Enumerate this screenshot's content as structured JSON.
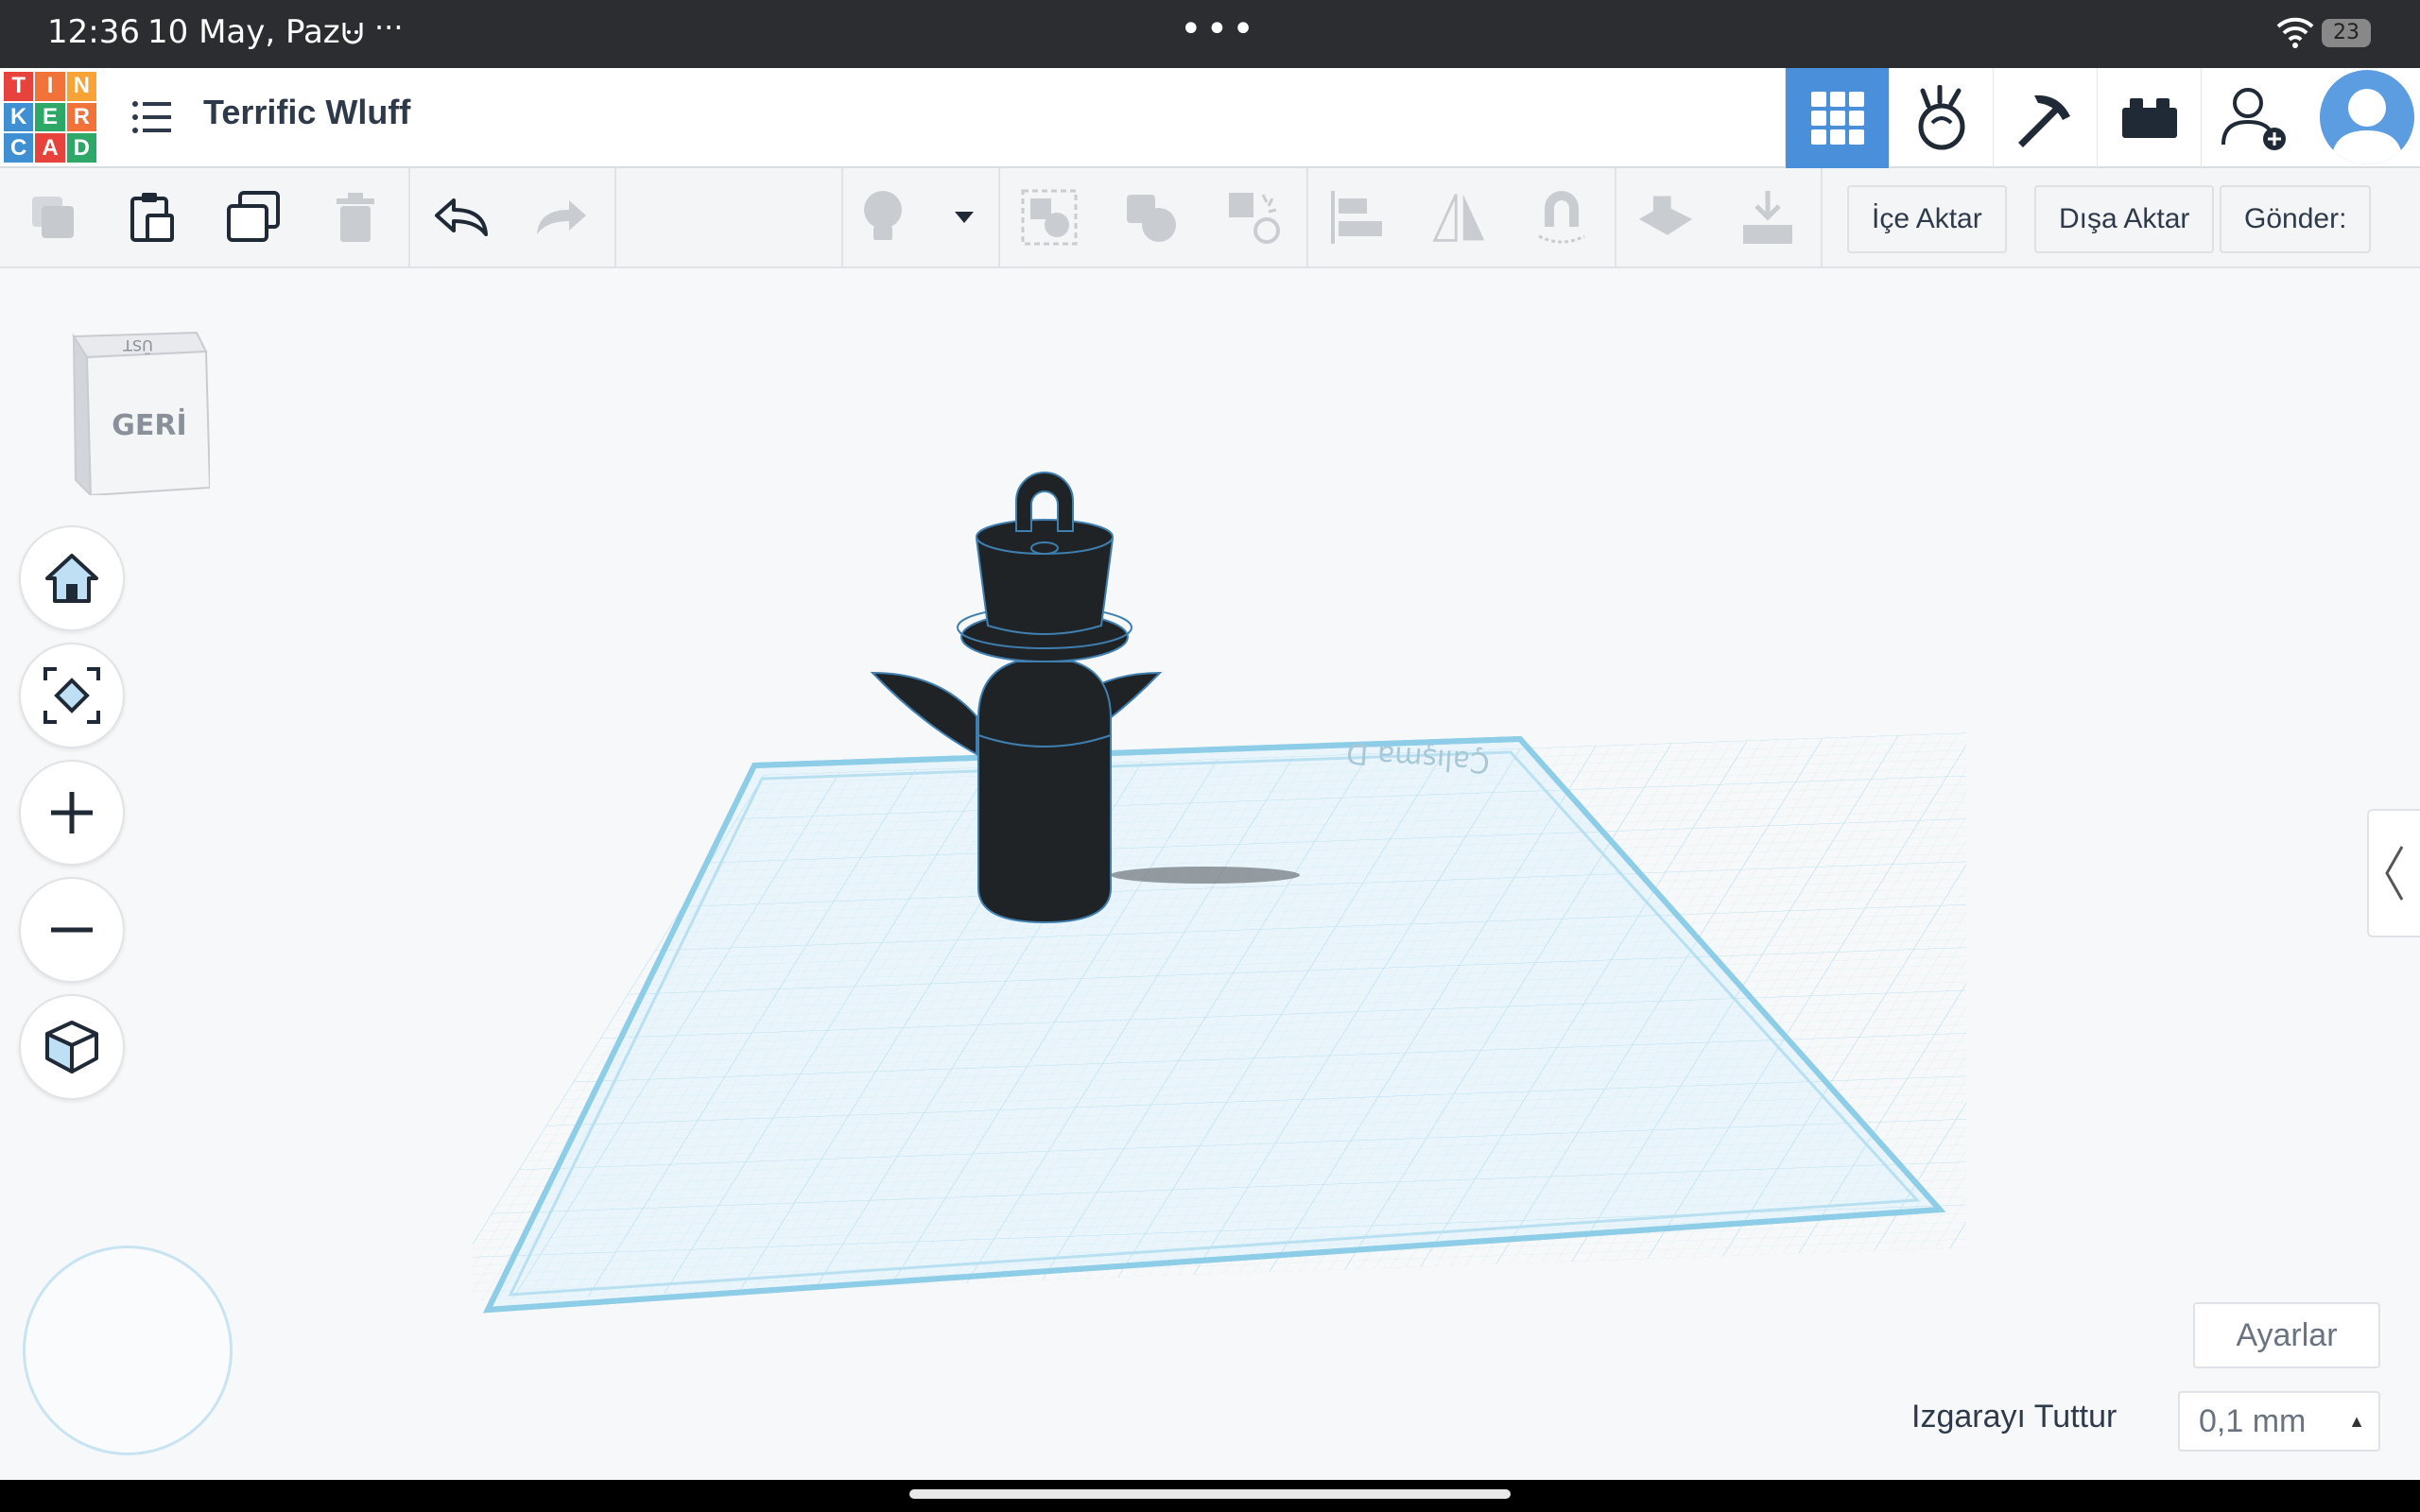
{
  "status": {
    "time": "12:36",
    "date": "10 May, Paz",
    "more": "···",
    "battery": "23"
  },
  "header": {
    "logo_letters": [
      "T",
      "I",
      "N",
      "K",
      "E",
      "R",
      "C",
      "A",
      "D"
    ],
    "logo_colors": [
      "#e8423c",
      "#f2733a",
      "#f7a335",
      "#3f8fd3",
      "#2ea866",
      "#f2733a",
      "#3f8fd3",
      "#e8423c",
      "#2ea866"
    ],
    "project_title": "Terrific Wluff"
  },
  "toolbar": {
    "import_label": "İçe Aktar",
    "export_label": "Dışa Aktar",
    "send_label": "Gönder:"
  },
  "viewcube": {
    "front_label": "GERİ",
    "top_label": "ÜST"
  },
  "workplane": {
    "label": "Çalışma D"
  },
  "settings": {
    "settings_label": "Ayarlar",
    "snap_label": "Izgarayı Tuttur",
    "snap_value": "0,1 mm"
  },
  "colors": {
    "accent": "#4a8fd9",
    "grid": "#9ed3ea",
    "model": "#1f2326"
  },
  "icons": {
    "right": [
      "grid-view-icon",
      "sim-lab-icon",
      "minecraft-pickaxe-icon",
      "lego-brick-icon",
      "add-user-icon"
    ],
    "nav": [
      "home-icon",
      "fit-view-icon",
      "zoom-in-icon",
      "zoom-out-icon",
      "perspective-cube-icon"
    ]
  }
}
